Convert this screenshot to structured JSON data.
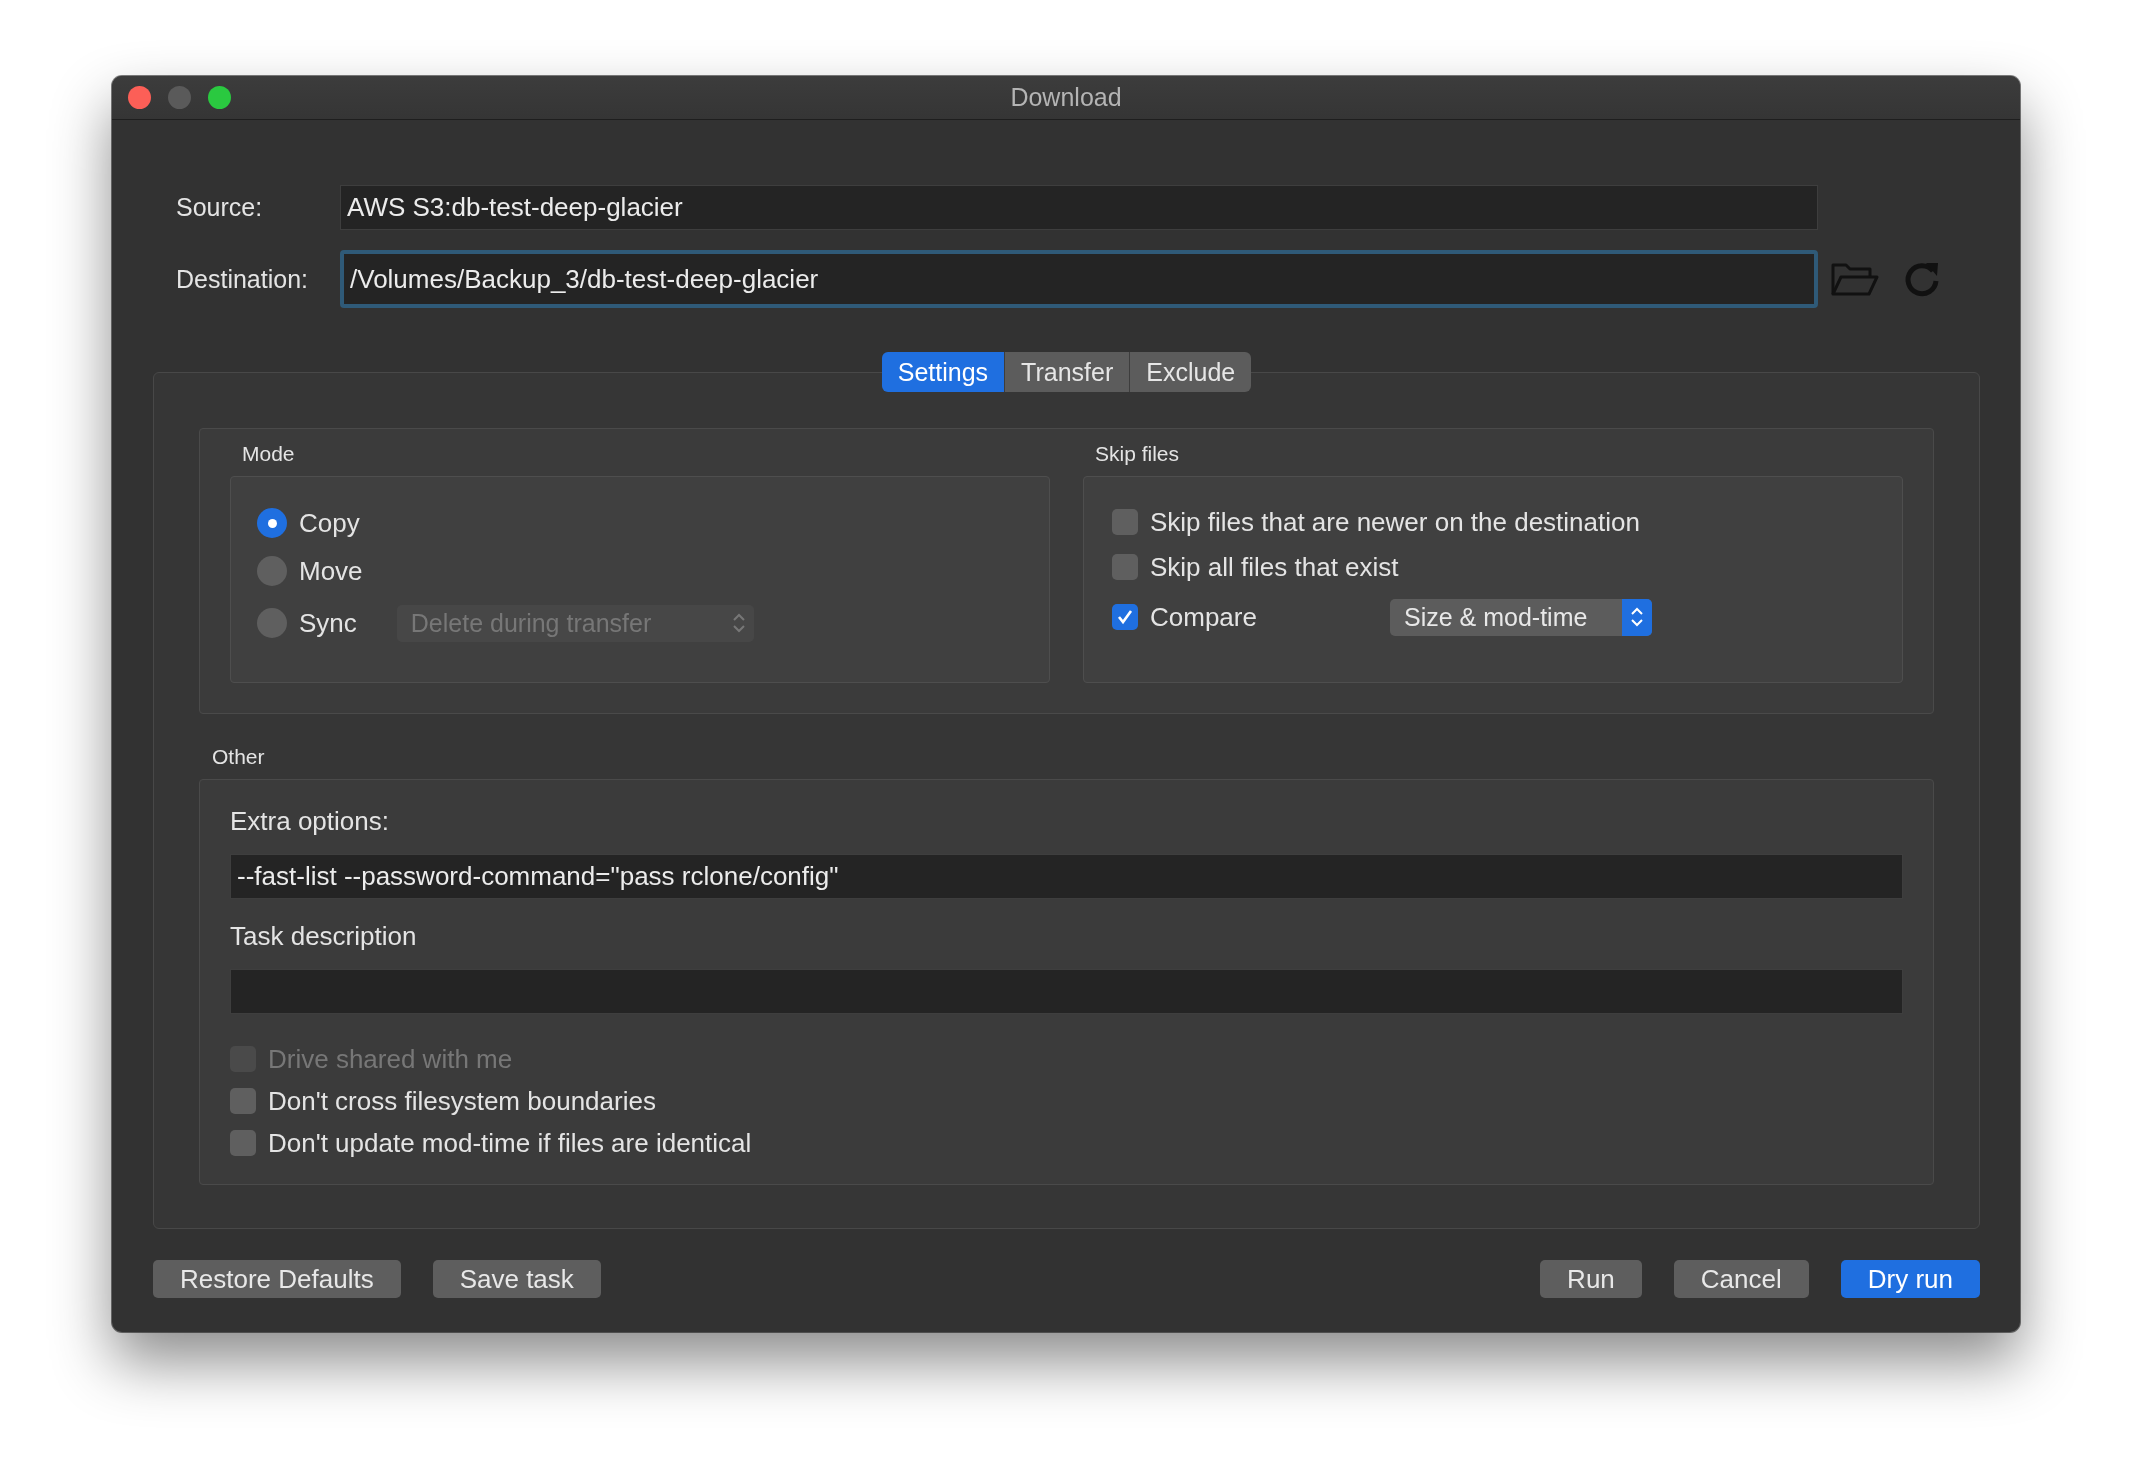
{
  "window": {
    "title": "Download"
  },
  "source": {
    "label": "Source:",
    "value": "AWS S3:db-test-deep-glacier",
    "focused": false
  },
  "destination": {
    "label": "Destination:",
    "value": "/Volumes/Backup_3/db-test-deep-glacier",
    "focused": true
  },
  "tabs": [
    {
      "label": "Settings",
      "selected": true
    },
    {
      "label": "Transfer",
      "selected": false
    },
    {
      "label": "Exclude",
      "selected": false
    }
  ],
  "mode": {
    "title": "Mode",
    "options": [
      {
        "label": "Copy",
        "selected": true
      },
      {
        "label": "Move",
        "selected": false
      },
      {
        "label": "Sync",
        "selected": false,
        "dropdown": {
          "value": "Delete during transfer",
          "disabled": true
        }
      }
    ]
  },
  "skip_files": {
    "title": "Skip files",
    "options": [
      {
        "label": "Skip files that are newer on the destination",
        "checked": false
      },
      {
        "label": "Skip all files that exist",
        "checked": false
      },
      {
        "label": "Compare",
        "checked": true,
        "dropdown": {
          "value": "Size & mod-time",
          "disabled": false
        }
      }
    ]
  },
  "other": {
    "title": "Other",
    "extra_options": {
      "label": "Extra options:",
      "value": "--fast-list --password-command=\"pass rclone/config\""
    },
    "task_description": {
      "label": "Task description"
    },
    "checkboxes": [
      {
        "label": "Drive shared with me",
        "checked": false,
        "disabled": true
      },
      {
        "label": "Don't cross filesystem boundaries",
        "checked": false,
        "disabled": false
      },
      {
        "label": "Don't update mod-time if files are identical",
        "checked": false,
        "disabled": false
      }
    ]
  },
  "buttons": {
    "left": [
      {
        "label": "Restore Defaults",
        "primary": false
      },
      {
        "label": "Save task",
        "primary": false
      }
    ],
    "right": [
      {
        "label": "Run",
        "primary": false
      },
      {
        "label": "Cancel",
        "primary": false
      },
      {
        "label": "Dry run",
        "primary": true
      }
    ]
  }
}
